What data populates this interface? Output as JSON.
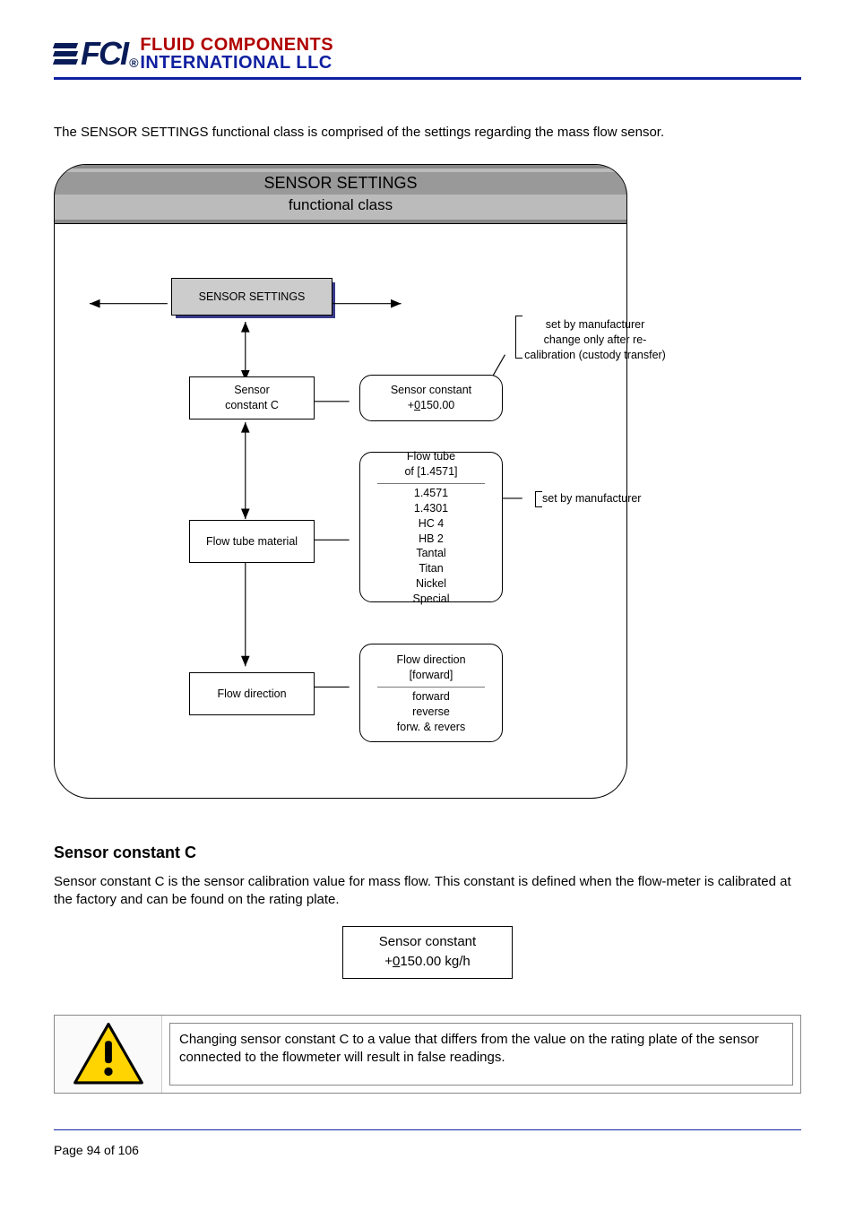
{
  "header": {
    "brand_top": "FLUID COMPONENTS",
    "brand_bottom": "INTERNATIONAL LLC",
    "brand_mark": "FCI"
  },
  "intro": "The SENSOR SETTINGS functional class is comprised of the settings regarding the mass flow sensor.",
  "diagram": {
    "title": "SENSOR SETTINGS",
    "subtitle": "functional class",
    "main": "SENSOR SETTINGS",
    "sensor_constant": {
      "label_l1": "Sensor",
      "label_l2": "constant C"
    },
    "flow_tube_material": "Flow tube material",
    "flow_direction": "Flow direction",
    "opt_sensor_constant": {
      "l1": "Sensor constant",
      "l2_prefix": "+",
      "l2_u": "0",
      "l2_rest": "150.00"
    },
    "opt_flow_tube": {
      "hdr_l1": "Flow tube",
      "hdr_l2": "of [1.4571]",
      "items": [
        "1.4571",
        "1.4301",
        "HC 4",
        "HB 2",
        "Tantal",
        "Titan",
        "Nickel",
        "Special"
      ]
    },
    "opt_flow_direction": {
      "hdr_l1": "Flow direction",
      "hdr_l2": "[forward]",
      "items": [
        "forward",
        "reverse",
        "forw. & revers"
      ]
    },
    "note1_l1": "set by manufacturer",
    "note1_l2": "change only after re-",
    "note1_l3": "calibration (custody transfer)",
    "note2": "set by manufacturer"
  },
  "section": {
    "heading": "Sensor constant C",
    "para": "Sensor constant C is the sensor calibration value for mass flow. This constant is defined when the flow-meter is calibrated at the factory and can be found on the rating plate.",
    "box_l1": "Sensor constant",
    "box_l2_prefix": "+",
    "box_l2_u": "0",
    "box_l2_rest": "150.00 kg/h"
  },
  "warning": "Changing sensor constant C to a value that differs from the value on the rating plate of the sensor connected to the flowmeter will result in false readings.",
  "footer": "Page 94 of 106",
  "chart_data": {
    "type": "diagram",
    "title": "SENSOR SETTINGS functional class",
    "root": "SENSOR SETTINGS",
    "children": [
      {
        "name": "Sensor constant C",
        "option_display": "Sensor constant +0150.00",
        "note": "set by manufacturer — change only after recalibration (custody transfer)"
      },
      {
        "name": "Flow tube material",
        "option_display_header": "Flow tube of [1.4571]",
        "options": [
          "1.4571",
          "1.4301",
          "HC 4",
          "HB 2",
          "Tantal",
          "Titan",
          "Nickel",
          "Special"
        ],
        "note": "set by manufacturer"
      },
      {
        "name": "Flow direction",
        "option_display_header": "Flow direction [forward]",
        "options": [
          "forward",
          "reverse",
          "forw. & revers"
        ]
      }
    ]
  }
}
